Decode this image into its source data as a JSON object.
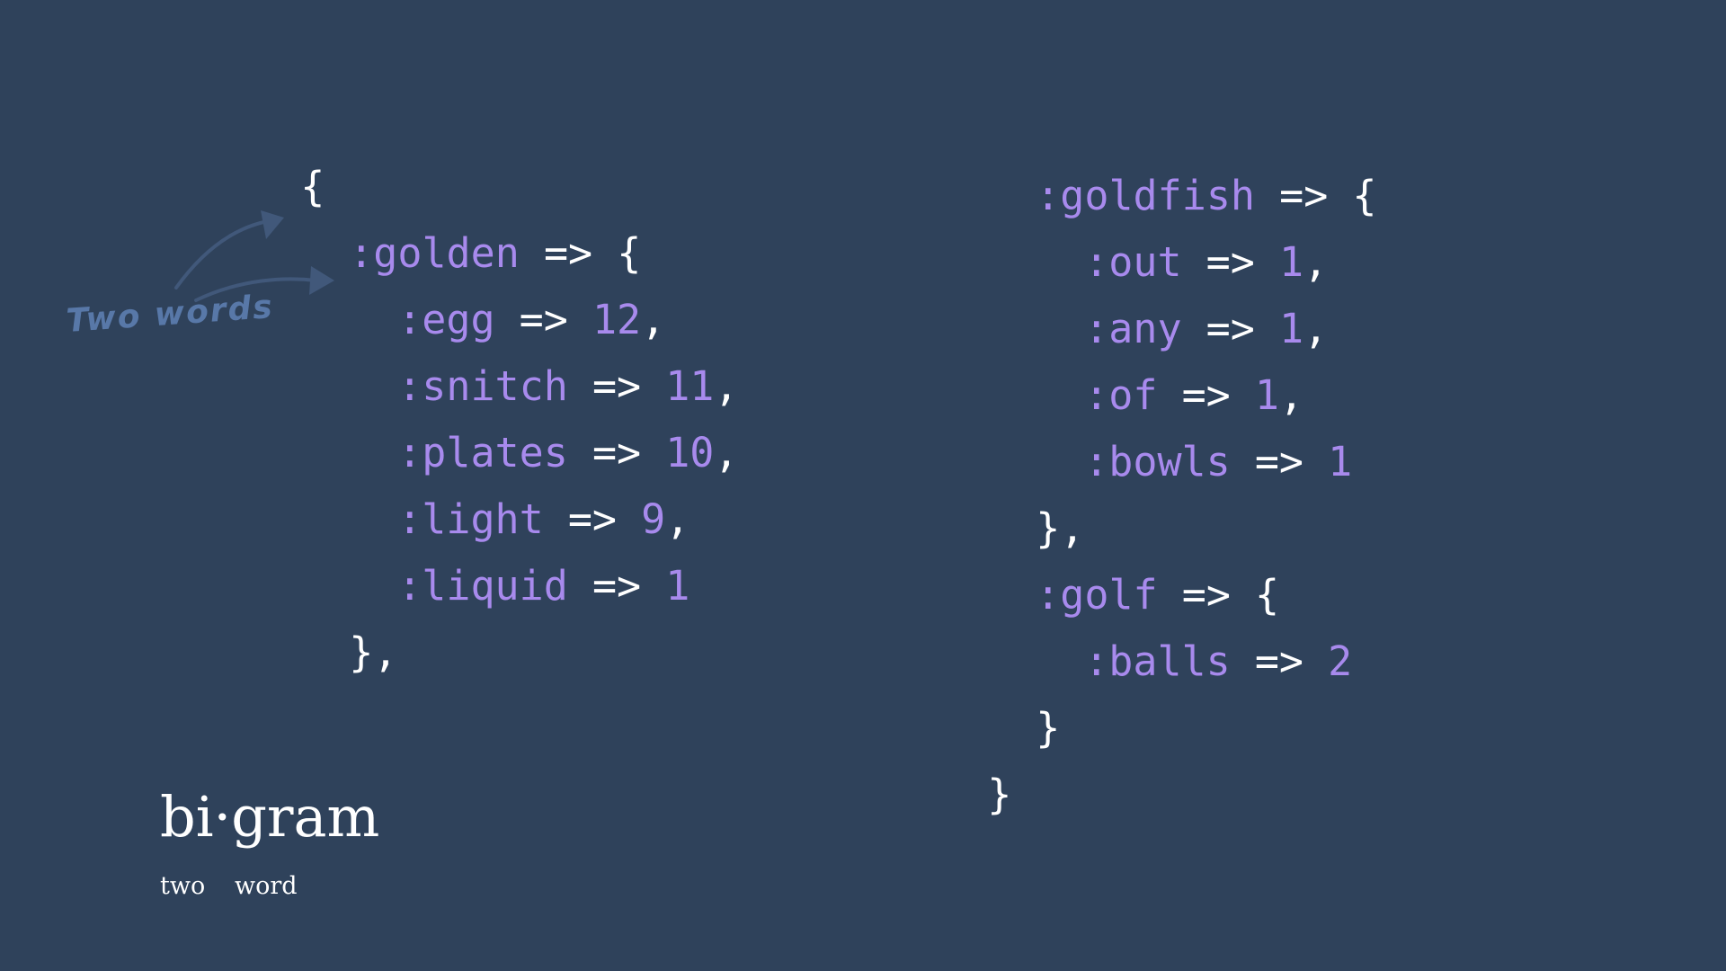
{
  "colors": {
    "background": "#2f425b",
    "symbol": "#a88aed",
    "number": "#a88aed",
    "operator": "#ffffff",
    "annotation": "#5878a8"
  },
  "code": {
    "open_brace": "{",
    "golden": {
      "key": ":golden",
      "arrow": "=>",
      "open": "{",
      "entries": [
        {
          "key": ":egg",
          "arrow": "=>",
          "value": "12",
          "comma": ","
        },
        {
          "key": ":snitch",
          "arrow": "=>",
          "value": "11",
          "comma": ","
        },
        {
          "key": ":plates",
          "arrow": "=>",
          "value": "10",
          "comma": ","
        },
        {
          "key": ":light",
          "arrow": "=>",
          "value": "9",
          "comma": ","
        },
        {
          "key": ":liquid",
          "arrow": "=>",
          "value": "1",
          "comma": ""
        }
      ],
      "close": "},"
    },
    "goldfish": {
      "key": ":goldfish",
      "arrow": "=>",
      "open": "{",
      "entries": [
        {
          "key": ":out",
          "arrow": "=>",
          "value": "1",
          "comma": ","
        },
        {
          "key": ":any",
          "arrow": "=>",
          "value": "1",
          "comma": ","
        },
        {
          "key": ":of",
          "arrow": "=>",
          "value": "1",
          "comma": ","
        },
        {
          "key": ":bowls",
          "arrow": "=>",
          "value": "1",
          "comma": ""
        }
      ],
      "close": "},"
    },
    "golf": {
      "key": ":golf",
      "arrow": "=>",
      "open": "{",
      "entries": [
        {
          "key": ":balls",
          "arrow": "=>",
          "value": "2",
          "comma": ""
        }
      ],
      "close": "}"
    },
    "close_brace": "}"
  },
  "annotation": {
    "text": "Two words"
  },
  "definition": {
    "word": "bi·gram",
    "parts": [
      "two",
      "word"
    ]
  }
}
